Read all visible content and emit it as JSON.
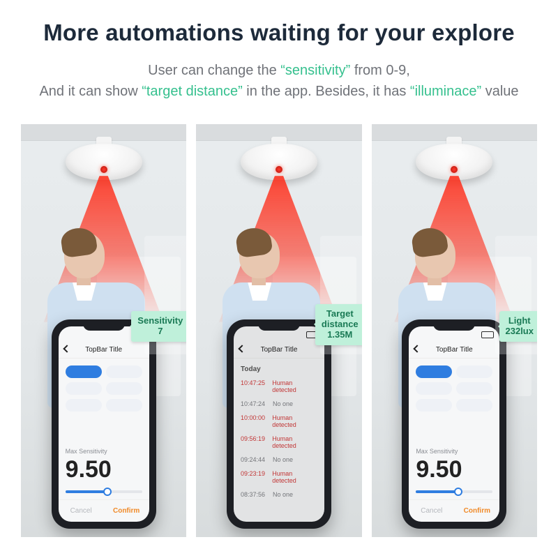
{
  "headline": "More automations waiting for your explore",
  "sub_prefix": "User can change the",
  "sub_kw1": "“sensitivity”",
  "sub_suffix1": "from 0-9,",
  "sub2_prefix": "And it can show",
  "sub_kw2": "“target distance”",
  "sub2_mid": "in the app. Besides, it has",
  "sub_kw3": "“illuminace”",
  "sub2_suffix": "value",
  "phone": {
    "titlebar": "TopBar Title",
    "section_label": "Max Sensitivity",
    "big_value": "9.50",
    "footer_cancel": "Cancel",
    "footer_confirm": "Confirm",
    "today": "Today",
    "logs": [
      {
        "t": "10:47:25",
        "s": "Human detected",
        "hit": true
      },
      {
        "t": "10:47:24",
        "s": "No one",
        "hit": false
      },
      {
        "t": "10:00:00",
        "s": "Human detected",
        "hit": true
      },
      {
        "t": "09:56:19",
        "s": "Human detected",
        "hit": true
      },
      {
        "t": "09:24:44",
        "s": "No one",
        "hit": false
      },
      {
        "t": "09:23:19",
        "s": "Human detected",
        "hit": true
      },
      {
        "t": "08:37:56",
        "s": "No one",
        "hit": false
      }
    ]
  },
  "callouts": {
    "a_line1": "Sensitivity",
    "a_line2": "7",
    "b_line1": "Target",
    "b_line2": "distance",
    "b_line3": "1.35M",
    "c_line1": "Light",
    "c_line2": "232lux"
  }
}
